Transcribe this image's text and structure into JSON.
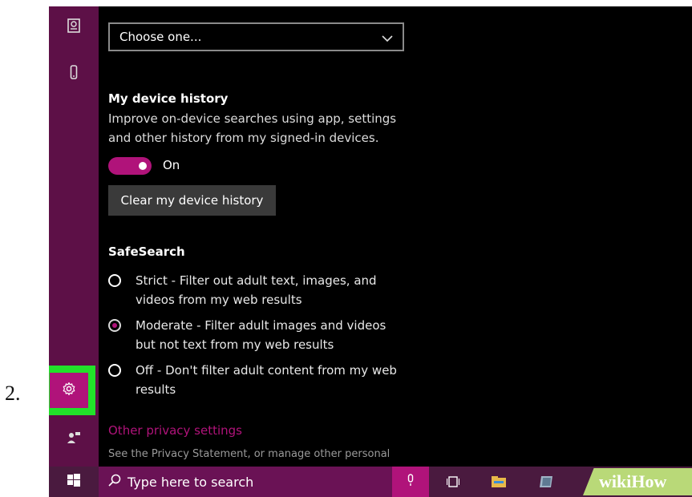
{
  "step_number": "2.",
  "panel": {
    "dropdown_value": "Choose one...",
    "device_history": {
      "title": "My device history",
      "description_line1": "Improve on-device searches using app, settings",
      "description_line2": "and other history from my signed-in devices.",
      "toggle_state": "On",
      "clear_button": "Clear my device history"
    },
    "safesearch": {
      "title": "SafeSearch",
      "options": [
        {
          "line1": "Strict - Filter out adult text, images, and",
          "line2": "videos from my web results",
          "selected": false
        },
        {
          "line1": "Moderate - Filter adult images and videos",
          "line2": "but not text from my web results",
          "selected": true
        },
        {
          "line1": "Off - Don't filter adult content from my web",
          "line2": "results",
          "selected": false
        }
      ]
    },
    "other_privacy_link": "Other privacy settings",
    "privacy_description": "See the Privacy Statement, or manage other personal"
  },
  "taskbar": {
    "search_placeholder": "Type here to search"
  },
  "watermark": "wikiHow",
  "colors": {
    "accent": "#b0137a",
    "sidebar": "#5d1047",
    "highlight": "#22e12a",
    "background": "#000000"
  }
}
